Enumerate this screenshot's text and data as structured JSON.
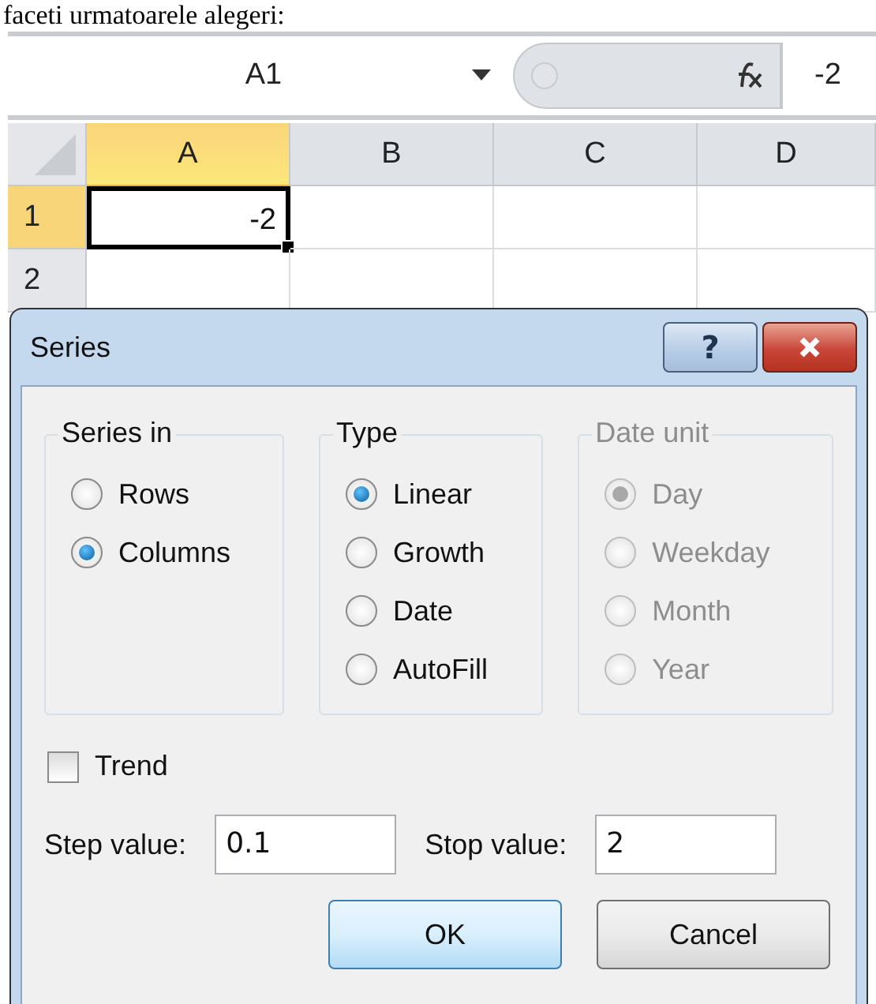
{
  "caption": "faceti urmatoarele alegeri:",
  "name_box": {
    "value": "A1"
  },
  "formula": {
    "value": "-2"
  },
  "grid": {
    "columns": [
      {
        "label": "A",
        "selected": true
      },
      {
        "label": "B",
        "selected": false
      },
      {
        "label": "C",
        "selected": false
      },
      {
        "label": "D",
        "selected": false
      }
    ],
    "rows": [
      {
        "label": "1",
        "selected": true,
        "cells": [
          "-2"
        ]
      },
      {
        "label": "2",
        "selected": false,
        "cells": []
      }
    ]
  },
  "dialog": {
    "title": "Series",
    "help_button": "?",
    "groups": [
      {
        "legend": "Series in",
        "disabled": false,
        "options": [
          {
            "label": "Rows",
            "selected": false
          },
          {
            "label": "Columns",
            "selected": true
          }
        ]
      },
      {
        "legend": "Type",
        "disabled": false,
        "options": [
          {
            "label": "Linear",
            "selected": true
          },
          {
            "label": "Growth",
            "selected": false
          },
          {
            "label": "Date",
            "selected": false
          },
          {
            "label": "AutoFill",
            "selected": false
          }
        ]
      },
      {
        "legend": "Date unit",
        "disabled": true,
        "options": [
          {
            "label": "Day",
            "selected": true
          },
          {
            "label": "Weekday",
            "selected": false
          },
          {
            "label": "Month",
            "selected": false
          },
          {
            "label": "Year",
            "selected": false
          }
        ]
      }
    ],
    "trend": {
      "label": "Trend",
      "checked": false
    },
    "fields": [
      {
        "label": "Step value:",
        "value": "0.1"
      },
      {
        "label": "Stop value:",
        "value": "2"
      }
    ],
    "buttons": [
      {
        "label": "OK",
        "default": true
      },
      {
        "label": "Cancel",
        "default": false
      }
    ]
  }
}
